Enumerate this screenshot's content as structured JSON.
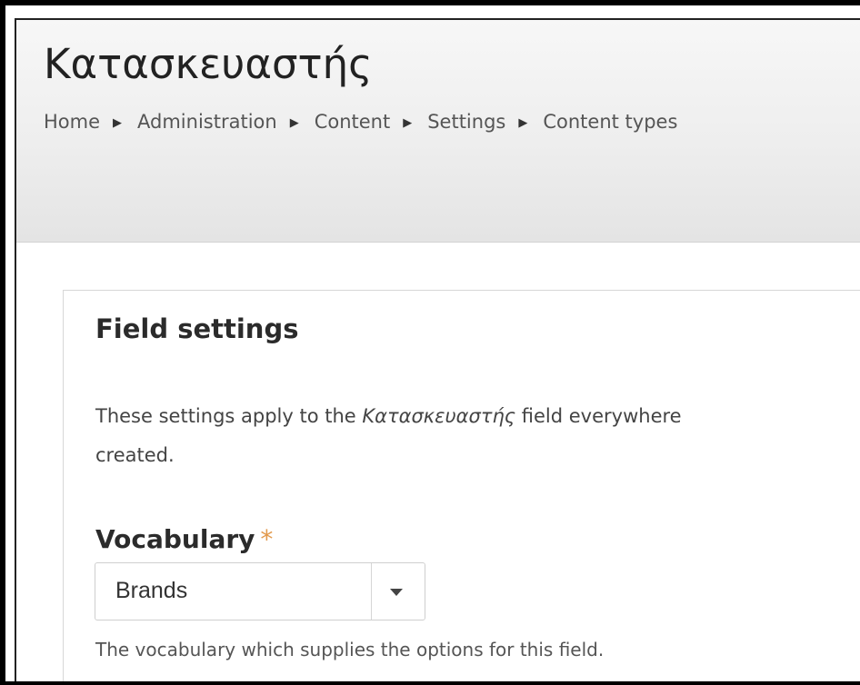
{
  "page": {
    "title": "Κατασκευαστής"
  },
  "breadcrumb": {
    "items": [
      "Home",
      "Administration",
      "Content",
      "Settings",
      "Content types"
    ],
    "separator": "▶"
  },
  "field_settings": {
    "heading": "Field settings",
    "description_prefix": "These settings apply to the ",
    "description_field_name": "Κατασκευαστής",
    "description_suffix": " field everywhere",
    "description_line2": "created.",
    "vocabulary": {
      "label": "Vocabulary",
      "required_marker": "*",
      "selected_value": "Brands",
      "help_text": "The vocabulary which supplies the options for this field."
    }
  },
  "colors": {
    "required": "#e29a4e",
    "header_background": "#eeeeee",
    "text": "#444444"
  },
  "icons": {
    "breadcrumb_separator": "triangle-right-icon",
    "select_arrow": "chevron-down-icon"
  }
}
